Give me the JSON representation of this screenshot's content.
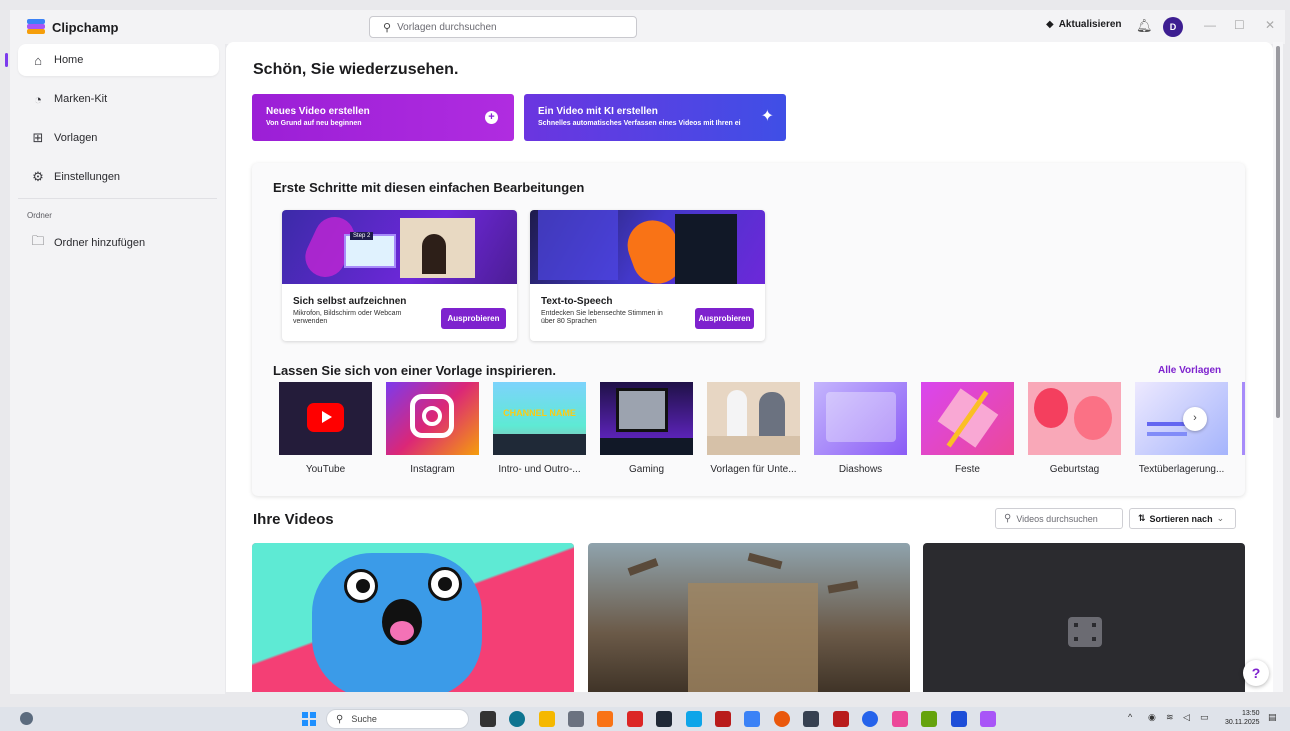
{
  "titlebar": {
    "app_name": "Clipchamp",
    "search_placeholder": "Vorlagen durchsuchen",
    "upgrade_label": "Aktualisieren",
    "avatar_initial": "D"
  },
  "sidebar": {
    "items": [
      {
        "label": "Home",
        "icon": "home-icon"
      },
      {
        "label": "Marken-Kit",
        "icon": "brand-kit-icon"
      },
      {
        "label": "Vorlagen",
        "icon": "templates-icon"
      },
      {
        "label": "Einstellungen",
        "icon": "gear-icon"
      }
    ],
    "section_label": "Ordner",
    "add_folder_label": "Ordner hinzufügen"
  },
  "main": {
    "greeting": "Schön, Sie wiederzusehen.",
    "cta_new": {
      "title": "Neues Video erstellen",
      "subtitle": "Von Grund auf neu beginnen",
      "color": "#9b1fd6"
    },
    "cta_ai": {
      "title": "Ein Video mit KI erstellen",
      "subtitle": "Schnelles automatisches Verfassen eines Videos mit Ihren ei",
      "color": "#4f3ddc"
    },
    "first_steps": {
      "title": "Erste Schritte mit diesen einfachen Bearbeitungen",
      "cards": [
        {
          "title": "Sich selbst aufzeichnen",
          "desc": "Mikrofon, Bildschirm oder Webcam verwenden",
          "button": "Ausprobieren",
          "thumb_label": "Step 2"
        },
        {
          "title": "Text-to-Speech",
          "desc": "Entdecken Sie lebensechte Stimmen in über 80 Sprachen",
          "button": "Ausprobieren"
        }
      ]
    },
    "inspire": {
      "title": "Lassen Sie sich von einer Vorlage inspirieren.",
      "all_link": "Alle Vorlagen",
      "templates": [
        {
          "label": "YouTube"
        },
        {
          "label": "Instagram"
        },
        {
          "label": "Intro- und Outro-...",
          "thumb_text": "CHANNEL NAME"
        },
        {
          "label": "Gaming"
        },
        {
          "label": "Vorlagen für Unte..."
        },
        {
          "label": "Diashows"
        },
        {
          "label": "Feste"
        },
        {
          "label": "Geburtstag"
        },
        {
          "label": "Textüberlagerung..."
        }
      ],
      "next_glyph": "›"
    },
    "videos": {
      "title": "Ihre Videos",
      "search_placeholder": "Videos durchsuchen",
      "sort_label": "Sortieren nach"
    }
  },
  "help_label": "?",
  "taskbar": {
    "search_label": "Suche",
    "time": "13:50",
    "date": "30.11.2025"
  }
}
